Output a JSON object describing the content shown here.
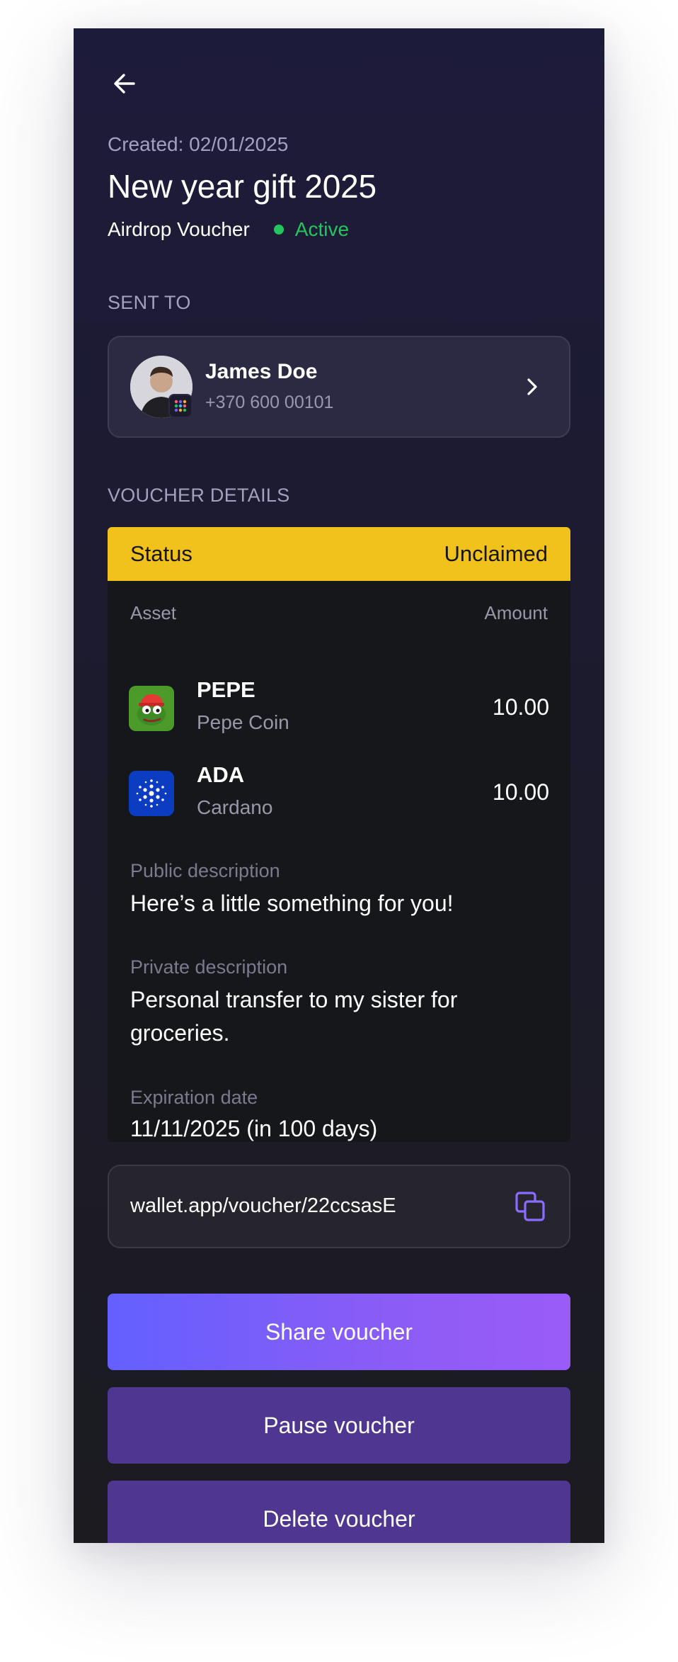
{
  "header": {
    "created": "Created: 02/01/2025",
    "title": "New year gift 2025",
    "voucher_type": "Airdrop Voucher",
    "status": "Active",
    "status_color": "#22c55e"
  },
  "sent_to": {
    "label": "SENT TO",
    "name": "James Doe",
    "phone": "+370 600 00101"
  },
  "voucher_details": {
    "label": "VOUCHER DETAILS",
    "status_label": "Status",
    "status_value": "Unclaimed",
    "status_color": "#f1c21b",
    "asset_header": "Asset",
    "amount_header": "Amount",
    "assets": [
      {
        "symbol": "PEPE",
        "name": "Pepe Coin",
        "amount": "10.00",
        "icon": "pepe-icon"
      },
      {
        "symbol": "ADA",
        "name": "Cardano",
        "amount": "10.00",
        "icon": "cardano-icon"
      }
    ],
    "public_description_label": "Public description",
    "public_description": "Here’s a little something for you!",
    "private_description_label": "Private description",
    "private_description": "Personal transfer to my sister for groceries.",
    "expiration_label": "Expiration date",
    "expiration_value": "11/11/2025 (in 100 days)"
  },
  "link": {
    "url": "wallet.app/voucher/22ccsasE"
  },
  "actions": {
    "share": "Share voucher",
    "pause": "Pause voucher",
    "delete": "Delete voucher"
  },
  "colors": {
    "accent": "#6360ff",
    "secondary_button": "#4f3791"
  }
}
